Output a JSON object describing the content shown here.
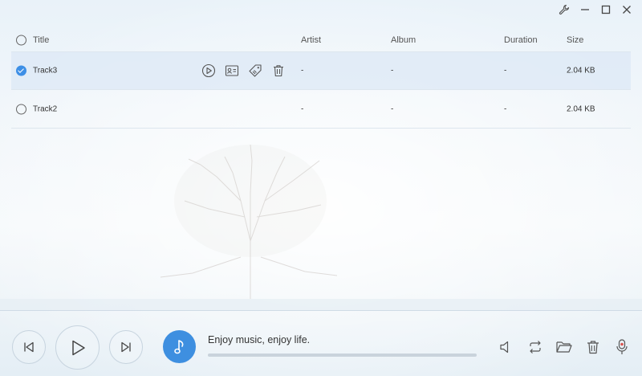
{
  "table": {
    "headers": {
      "title": "Title",
      "artist": "Artist",
      "album": "Album",
      "duration": "Duration",
      "size": "Size"
    },
    "rows": [
      {
        "title": "Track3",
        "artist": "-",
        "album": "-",
        "duration": "-",
        "size": "2.04 KB",
        "checked": true
      },
      {
        "title": "Track2",
        "artist": "-",
        "album": "-",
        "duration": "-",
        "size": "2.04 KB",
        "checked": false
      }
    ]
  },
  "player": {
    "tagline": "Enjoy music, enjoy life.",
    "progress": 0
  },
  "icons": {
    "window": [
      "wrench-icon",
      "minimize-icon",
      "maximize-icon",
      "close-icon"
    ],
    "row_actions": [
      "play-circle-icon",
      "contact-card-icon",
      "tags-icon",
      "trash-icon"
    ],
    "player": [
      "previous-icon",
      "play-icon",
      "next-icon",
      "music-note-icon"
    ],
    "right": [
      "volume-icon",
      "repeat-icon",
      "folder-icon",
      "trash-icon",
      "microphone-icon"
    ]
  },
  "colors": {
    "accent": "#3e8fe0",
    "check": "#3d8fe6",
    "selected_row": "#dce8f5"
  }
}
